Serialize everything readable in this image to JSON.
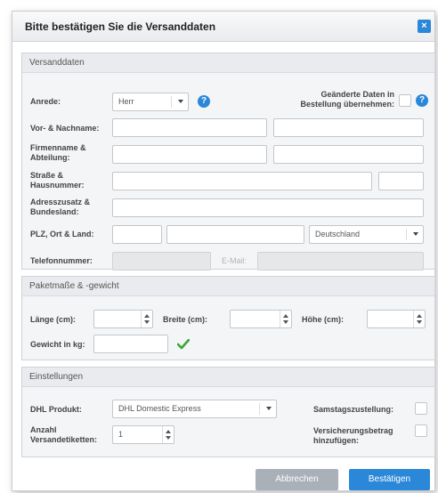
{
  "dialog": {
    "title": "Bitte bestätigen Sie die Versanddaten",
    "close_glyph": "×"
  },
  "versand": {
    "legend": "Versanddaten",
    "anrede_label": "Anrede:",
    "anrede_value": "Herr",
    "update_label": "Geänderte Daten in Bestellung übernehmen:",
    "name_label": "Vor- & Nachname:",
    "firma_label": "Firmenname & Abteilung:",
    "strasse_label": "Straße & Hausnummer:",
    "adresszusatz_label": "Adresszusatz & Bundesland:",
    "plz_label": "PLZ, Ort & Land:",
    "country_value": "Deutschland",
    "telefon_label": "Telefonnummer:",
    "email_label": "E-Mail:"
  },
  "paket": {
    "legend": "Paketmaße & -gewicht",
    "laenge_label": "Länge (cm):",
    "breite_label": "Breite (cm):",
    "hoehe_label": "Höhe (cm):",
    "gewicht_label": "Gewicht in kg:"
  },
  "einstellungen": {
    "legend": "Einstellungen",
    "produkt_label": "DHL Produkt:",
    "produkt_value": "DHL Domestic Express",
    "anzahl_label": "Anzahl Versandetiketten:",
    "anzahl_value": "1",
    "samstag_label": "Samstagszustellung:",
    "versicherung_label": "Versicherungsbetrag hinzufügen:"
  },
  "footer": {
    "cancel_label": "Abbrechen",
    "confirm_label": "Bestätigen"
  },
  "colors": {
    "accent": "#2b88d8",
    "check": "#3aa535",
    "cancel_button": "#a9b0b8"
  }
}
